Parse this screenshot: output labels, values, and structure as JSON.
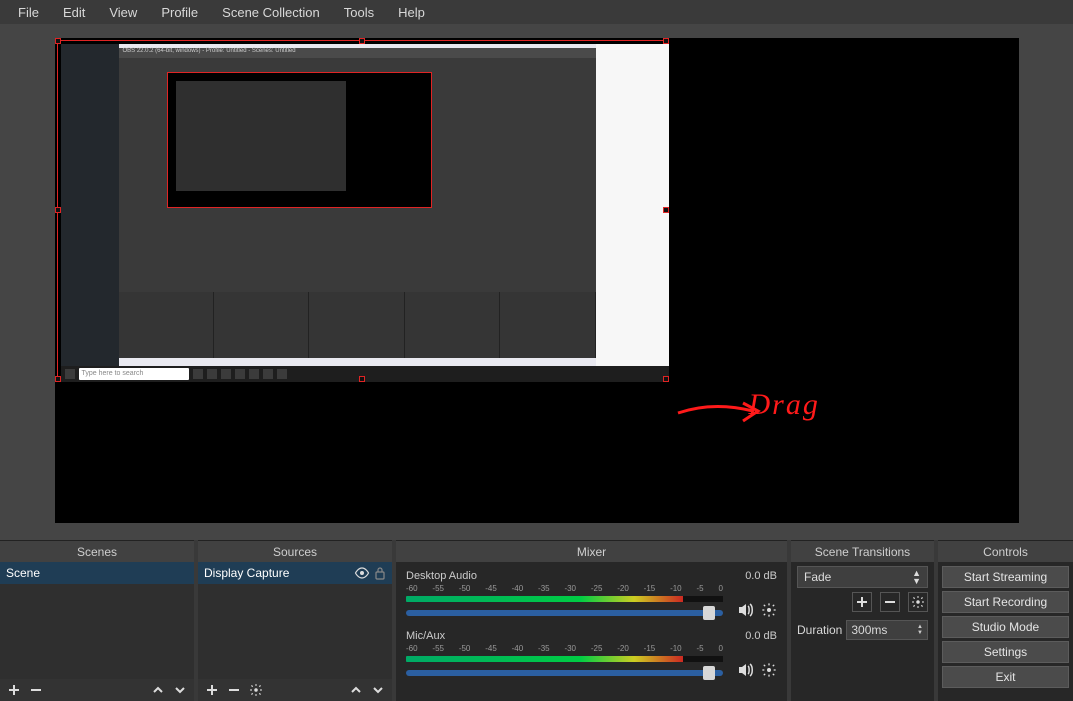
{
  "menubar": {
    "file": "File",
    "edit": "Edit",
    "view": "View",
    "profile": "Profile",
    "scene_collection": "Scene Collection",
    "tools": "Tools",
    "help": "Help"
  },
  "annotation": {
    "text": "Drag"
  },
  "preview": {
    "inner_title": "OBS 22.0.2 (64-bit, windows) - Profile: Untitled - Scenes: Untitled",
    "search_ph": "Type here to search"
  },
  "panels": {
    "scenes": "Scenes",
    "sources": "Sources",
    "mixer": "Mixer",
    "transitions": "Scene Transitions",
    "controls": "Controls"
  },
  "scenes": {
    "items": [
      {
        "label": "Scene"
      }
    ]
  },
  "sources": {
    "items": [
      {
        "label": "Display Capture",
        "visible": true,
        "locked": false
      }
    ]
  },
  "mixer": {
    "ticks": [
      "-60",
      "-55",
      "-50",
      "-45",
      "-40",
      "-35",
      "-30",
      "-25",
      "-20",
      "-15",
      "-10",
      "-5",
      "0"
    ],
    "channels": [
      {
        "name": "Desktop Audio",
        "db": "0.0 dB"
      },
      {
        "name": "Mic/Aux",
        "db": "0.0 dB"
      }
    ]
  },
  "transitions": {
    "current": "Fade",
    "duration_label": "Duration",
    "duration_value": "300ms"
  },
  "controls": {
    "start_streaming": "Start Streaming",
    "start_recording": "Start Recording",
    "studio_mode": "Studio Mode",
    "settings": "Settings",
    "exit": "Exit"
  }
}
